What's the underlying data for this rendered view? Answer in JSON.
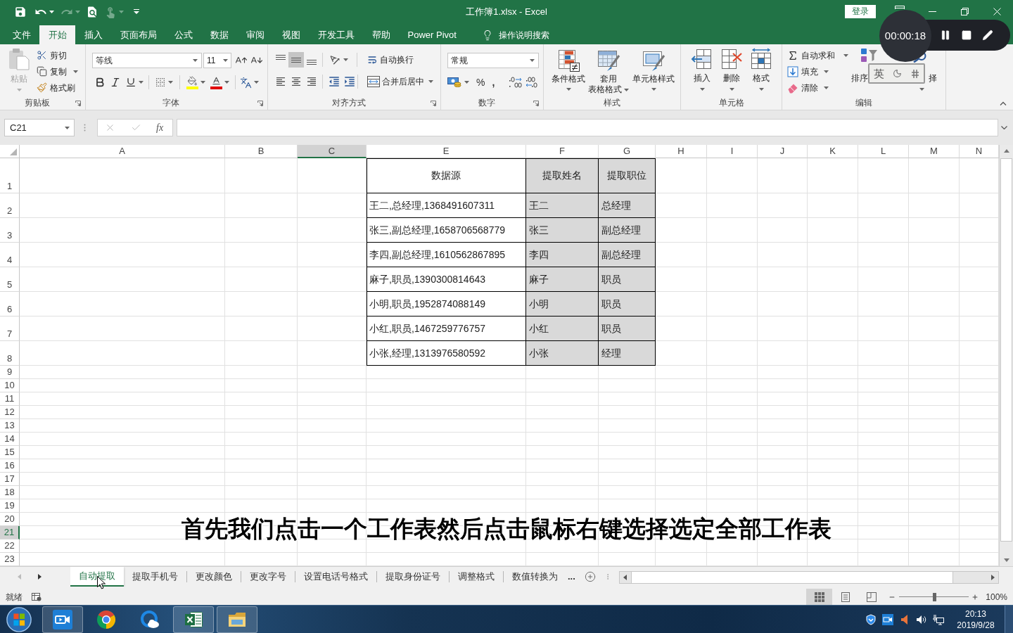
{
  "title_bar": {
    "title": "工作簿1.xlsx - Excel",
    "sign_in": "登录"
  },
  "menu_tabs": [
    {
      "label": "文件",
      "selected": false
    },
    {
      "label": "开始",
      "selected": true
    },
    {
      "label": "插入",
      "selected": false
    },
    {
      "label": "页面布局",
      "selected": false
    },
    {
      "label": "公式",
      "selected": false
    },
    {
      "label": "数据",
      "selected": false
    },
    {
      "label": "审阅",
      "selected": false
    },
    {
      "label": "视图",
      "selected": false
    },
    {
      "label": "开发工具",
      "selected": false
    },
    {
      "label": "帮助",
      "selected": false
    },
    {
      "label": "Power Pivot",
      "selected": false
    }
  ],
  "tell_me": {
    "placeholder": "操作说明搜索"
  },
  "ribbon": {
    "clipboard": {
      "label": "剪贴板",
      "paste": {
        "label": "粘贴",
        "disabled": true
      },
      "buttons": [
        {
          "label": "剪切"
        },
        {
          "label": "复制"
        },
        {
          "label": "格式刷"
        }
      ]
    },
    "font": {
      "label": "字体",
      "font_name": "等线",
      "font_size": "11"
    },
    "alignment": {
      "label": "对齐方式",
      "vertical": [
        {
          "selected": false
        },
        {
          "selected": true
        },
        {
          "selected": false
        }
      ],
      "wrap_text": "自动换行",
      "merge_center": "合并后居中"
    },
    "number": {
      "label": "数字",
      "format": "常规",
      "percent": "%",
      "comma": ","
    },
    "styles": {
      "label": "样式",
      "buttons": [
        {
          "lines": [
            "条件格式"
          ]
        },
        {
          "lines": [
            "套用",
            "表格格式"
          ]
        },
        {
          "lines": [
            "单元格样式"
          ]
        }
      ]
    },
    "cells": {
      "label": "单元格",
      "buttons": [
        {
          "label": "插入"
        },
        {
          "label": "删除"
        },
        {
          "label": "格式"
        }
      ]
    },
    "editing": {
      "label": "编辑",
      "buttons": [
        {
          "label": "自动求和"
        },
        {
          "label": "填充"
        },
        {
          "label": "清除"
        }
      ],
      "sort_filter": "排序",
      "find_select": "择"
    }
  },
  "recorder": {
    "time": "00:00:18"
  },
  "ime": {
    "mode": "英"
  },
  "formula_bar": {
    "name_box": "C21",
    "fx": "fx"
  },
  "sheet": {
    "columns": [
      {
        "label": "A",
        "selected": false
      },
      {
        "label": "B",
        "selected": false
      },
      {
        "label": "C",
        "selected": true
      },
      {
        "label": "E",
        "selected": false
      },
      {
        "label": "F",
        "selected": false
      },
      {
        "label": "G",
        "selected": false
      },
      {
        "label": "H",
        "selected": false
      },
      {
        "label": "I",
        "selected": false
      },
      {
        "label": "J",
        "selected": false
      },
      {
        "label": "K",
        "selected": false
      },
      {
        "label": "L",
        "selected": false
      },
      {
        "label": "M",
        "selected": false
      },
      {
        "label": "N",
        "selected": false
      }
    ],
    "rows": [
      {
        "label": "1",
        "selected": false
      },
      {
        "label": "2",
        "selected": false
      },
      {
        "label": "3",
        "selected": false
      },
      {
        "label": "4",
        "selected": false
      },
      {
        "label": "5",
        "selected": false
      },
      {
        "label": "6",
        "selected": false
      },
      {
        "label": "7",
        "selected": false
      },
      {
        "label": "8",
        "selected": false
      },
      {
        "label": "9",
        "selected": false
      },
      {
        "label": "10",
        "selected": false
      },
      {
        "label": "11",
        "selected": false
      },
      {
        "label": "12",
        "selected": false
      },
      {
        "label": "13",
        "selected": false
      },
      {
        "label": "14",
        "selected": false
      },
      {
        "label": "15",
        "selected": false
      },
      {
        "label": "16",
        "selected": false
      },
      {
        "label": "17",
        "selected": false
      },
      {
        "label": "18",
        "selected": false
      },
      {
        "label": "19",
        "selected": false
      },
      {
        "label": "20",
        "selected": false
      },
      {
        "label": "21",
        "selected": true
      },
      {
        "label": "22",
        "selected": false
      },
      {
        "label": "23",
        "selected": false
      }
    ],
    "table": {
      "header": [
        "数据源",
        "提取姓名",
        "提取职位"
      ],
      "rows": [
        [
          "王二,总经理,1368491607311",
          "王二",
          "总经理"
        ],
        [
          "张三,副总经理,1658706568779",
          "张三",
          "副总经理"
        ],
        [
          "李四,副总经理,1610562867895",
          "李四",
          "副总经理"
        ],
        [
          "麻子,职员,1390300814643",
          "麻子",
          "职员"
        ],
        [
          "小明,职员,1952874088149",
          "小明",
          "职员"
        ],
        [
          "小红,职员,1467259776757",
          "小红",
          "职员"
        ],
        [
          "小张,经理,1313976580592",
          "小张",
          "经理"
        ]
      ]
    }
  },
  "subtitle": "首先我们点击一个工作表然后点击鼠标右键选择选定全部工作表",
  "sheet_tabs": {
    "tabs": [
      {
        "label": "自动提取",
        "selected": true
      },
      {
        "label": "提取手机号",
        "selected": false
      },
      {
        "label": "更改颜色",
        "selected": false
      },
      {
        "label": "更改字号",
        "selected": false
      },
      {
        "label": "设置电话号格式",
        "selected": false
      },
      {
        "label": "提取身份证号",
        "selected": false
      },
      {
        "label": "调整格式",
        "selected": false
      },
      {
        "label": "数值转换为",
        "selected": false
      }
    ],
    "more": "..."
  },
  "status_bar": {
    "status": "就绪",
    "views": [
      {
        "selected": true
      },
      {
        "selected": false
      },
      {
        "selected": false
      }
    ],
    "zoom": {
      "level": 0.5,
      "reading": "100%"
    }
  },
  "taskbar": {
    "apps": [
      {
        "active": true
      },
      {
        "active": false
      },
      {
        "active": false
      },
      {
        "active": true
      },
      {
        "active": true
      }
    ],
    "clock": {
      "time": "20:13",
      "date": "2019/9/28"
    }
  }
}
